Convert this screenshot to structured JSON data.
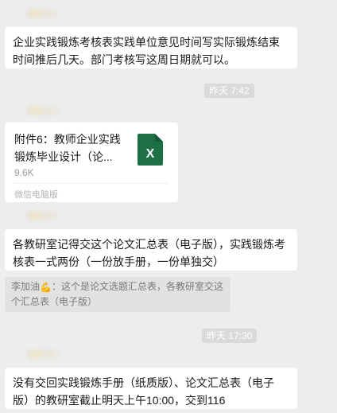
{
  "messages": [
    {
      "text": "企业实践锻炼考核表实践单位意见时间写实际锻炼结束时间推后几天。部门考核写这周日期就可以。"
    },
    {
      "timestamp": "昨天 7:42"
    },
    {
      "file": {
        "title": "附件6：教师企业实践锻炼毕业设计（论...",
        "size": "9.6K",
        "source": "微信电脑版",
        "icon": "excel-file-icon"
      }
    },
    {
      "text": "各教研室记得交这个论文汇总表（电子版），实践锻炼考核表一式两份（一份放手册，一份单独交）"
    },
    {
      "quote": {
        "name": "李加油",
        "emoji": "💪",
        "emoji_icon": "flexed-biceps-icon",
        "text": "：这个是论文选题汇总表，各教研室交这个汇总表（电子版）"
      }
    },
    {
      "timestamp": "昨天 17:30"
    },
    {
      "text": "没有交回实践锻炼手册（纸质版）、论文汇总表（电子版）的教研室截止明天上午10:00，交到116"
    }
  ],
  "colors": {
    "background": "#ededed",
    "bubble": "#ffffff",
    "timestamp_bg": "#dadada",
    "excel_green": "#1d7044"
  }
}
